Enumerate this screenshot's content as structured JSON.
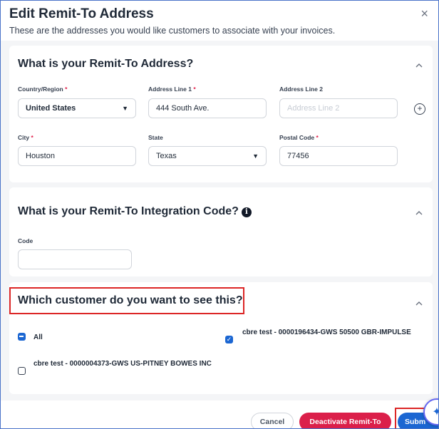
{
  "modal": {
    "title": "Edit Remit-To Address",
    "subtitle": "These are the addresses you would like customers to associate with your invoices.",
    "close_icon": "×"
  },
  "address_section": {
    "title": "What is your Remit-To Address?",
    "country_label": "Country/Region",
    "country_value": "United States",
    "address1_label": "Address Line 1",
    "address1_value": "444 South Ave.",
    "address2_label": "Address Line 2",
    "address2_placeholder": "Address Line 2",
    "city_label": "City",
    "city_value": "Houston",
    "state_label": "State",
    "state_value": "Texas",
    "postal_label": "Postal Code",
    "postal_value": "77456",
    "required_mark": "*"
  },
  "integration_section": {
    "title": "What is your Remit-To Integration Code?",
    "info_icon": "i",
    "code_label": "Code",
    "code_value": ""
  },
  "customer_section": {
    "title": "Which customer do you want to see this?",
    "options": [
      {
        "label": "All",
        "state": "partial"
      },
      {
        "label": "cbre test - 0000196434-GWS 50500 GBR-IMPULSE",
        "state": "checked"
      },
      {
        "label": "cbre test - 0000004373-GWS US-PITNEY BOWES INC",
        "state": "unchecked"
      }
    ]
  },
  "footer": {
    "cancel_label": "Cancel",
    "deactivate_label": "Deactivate Remit-To",
    "submit_label": "Subm"
  },
  "colors": {
    "primary": "#1b66d2",
    "danger": "#db1f4a",
    "highlight": "#dc2626"
  },
  "icons": {
    "chevron": "chevron-up-icon",
    "add": "plus-circle-icon",
    "assistant": "sparkle-icon"
  }
}
